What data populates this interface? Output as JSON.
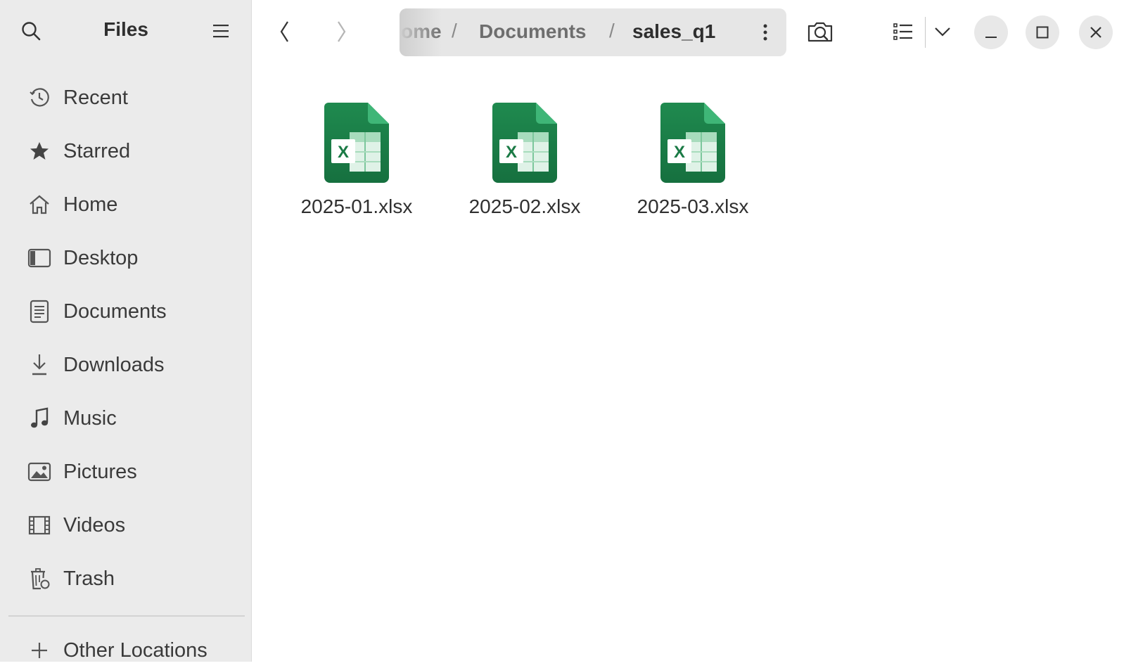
{
  "app": {
    "title": "Files"
  },
  "sidebar": {
    "items": [
      {
        "label": "Recent",
        "icon": "clock-icon"
      },
      {
        "label": "Starred",
        "icon": "star-icon"
      },
      {
        "label": "Home",
        "icon": "home-icon"
      },
      {
        "label": "Desktop",
        "icon": "desktop-icon"
      },
      {
        "label": "Documents",
        "icon": "document-icon"
      },
      {
        "label": "Downloads",
        "icon": "download-icon"
      },
      {
        "label": "Music",
        "icon": "music-icon"
      },
      {
        "label": "Pictures",
        "icon": "picture-icon"
      },
      {
        "label": "Videos",
        "icon": "video-icon"
      },
      {
        "label": "Trash",
        "icon": "trash-icon"
      }
    ],
    "other_locations": "Other Locations"
  },
  "path": {
    "crumbs": [
      "ome",
      "Documents",
      "sales_q1"
    ],
    "separator": "/"
  },
  "files": [
    {
      "name": "2025-01.xlsx",
      "icon": "spreadsheet-icon"
    },
    {
      "name": "2025-02.xlsx",
      "icon": "spreadsheet-icon"
    },
    {
      "name": "2025-03.xlsx",
      "icon": "spreadsheet-icon"
    }
  ],
  "colors": {
    "excel_green": "#1d7a46",
    "excel_green_light": "#2da464",
    "sidebar_bg": "#ebebeb"
  }
}
